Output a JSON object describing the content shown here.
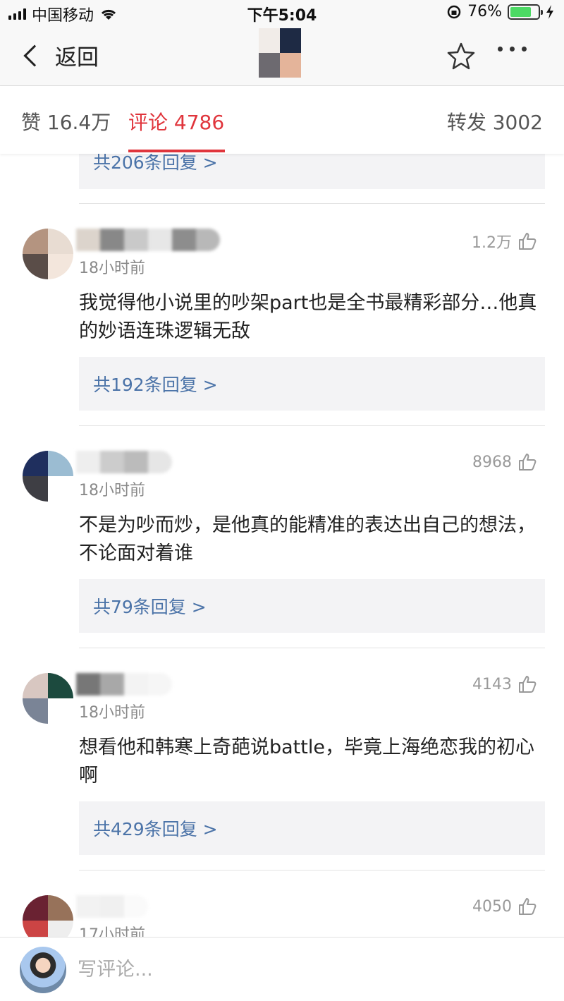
{
  "status_bar": {
    "carrier": "中国移动",
    "time": "下午5:04",
    "battery_percent": "76%",
    "battery_level": 0.76
  },
  "nav": {
    "back_label": "返回"
  },
  "tabs": [
    {
      "label": "赞 16.4万"
    },
    {
      "label": "评论 4786"
    },
    {
      "label": "转发 3002"
    }
  ],
  "active_tab": "评论 4786",
  "top_reply": "共206条回复 >",
  "comments": [
    {
      "time": "18小时前",
      "likes": "1.2万",
      "text": "我觉得他小说里的吵架part也是全书最精彩部分…他真的妙语连珠逻辑无敌",
      "replies": "共192条回复 >"
    },
    {
      "time": "18小时前",
      "likes": "8968",
      "text": "不是为吵而炒，是他真的能精准的表达出自己的想法，不论面对着谁",
      "replies": "共79条回复 >"
    },
    {
      "time": "18小时前",
      "likes": "4143",
      "text": "想看他和韩寒上奇葩说battle，毕竟上海绝恋我的初心啊",
      "replies": "共429条回复 >"
    },
    {
      "time": "17小时前",
      "likes": "4050"
    }
  ],
  "bottom": {
    "input_placeholder": "写评论..."
  },
  "colors": {
    "accent": "#e0353c",
    "link": "#4b73a8",
    "reply_bg": "#f3f3f5"
  }
}
